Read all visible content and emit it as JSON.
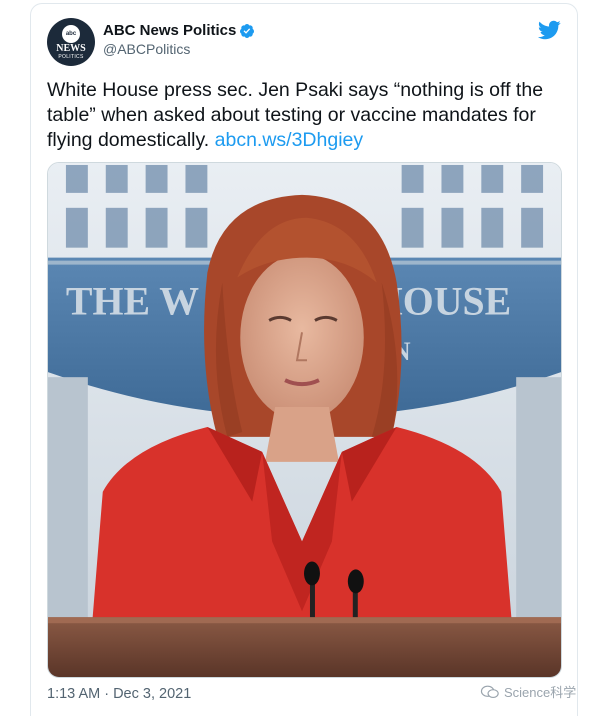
{
  "account": {
    "display_name": "ABC News Politics",
    "handle": "@ABCPolitics",
    "avatar_logo": {
      "top": "abc",
      "middle": "NEWS",
      "bottom": "POLITICS"
    }
  },
  "tweet": {
    "text": "White House press sec. Jen Psaki says “nothing is off the table” when asked about testing or vaccine mandates for flying domestically. ",
    "link": "abcn.ws/3Dhgiey",
    "timestamp": "1:13 AM · Dec 3, 2021"
  },
  "media": {
    "backdrop_text_left": "THE W",
    "backdrop_text_right": "HOUSE",
    "backdrop_text_lower": "ON"
  },
  "watermark": {
    "text": "Science科学"
  },
  "colors": {
    "link": "#1d9bf0",
    "verified": "#1d9bf0",
    "twitter_blue": "#1d9bf0"
  },
  "icons": {
    "verified": "verified-badge-icon",
    "brand": "twitter-bird-icon",
    "watermark": "wechat-icon"
  }
}
